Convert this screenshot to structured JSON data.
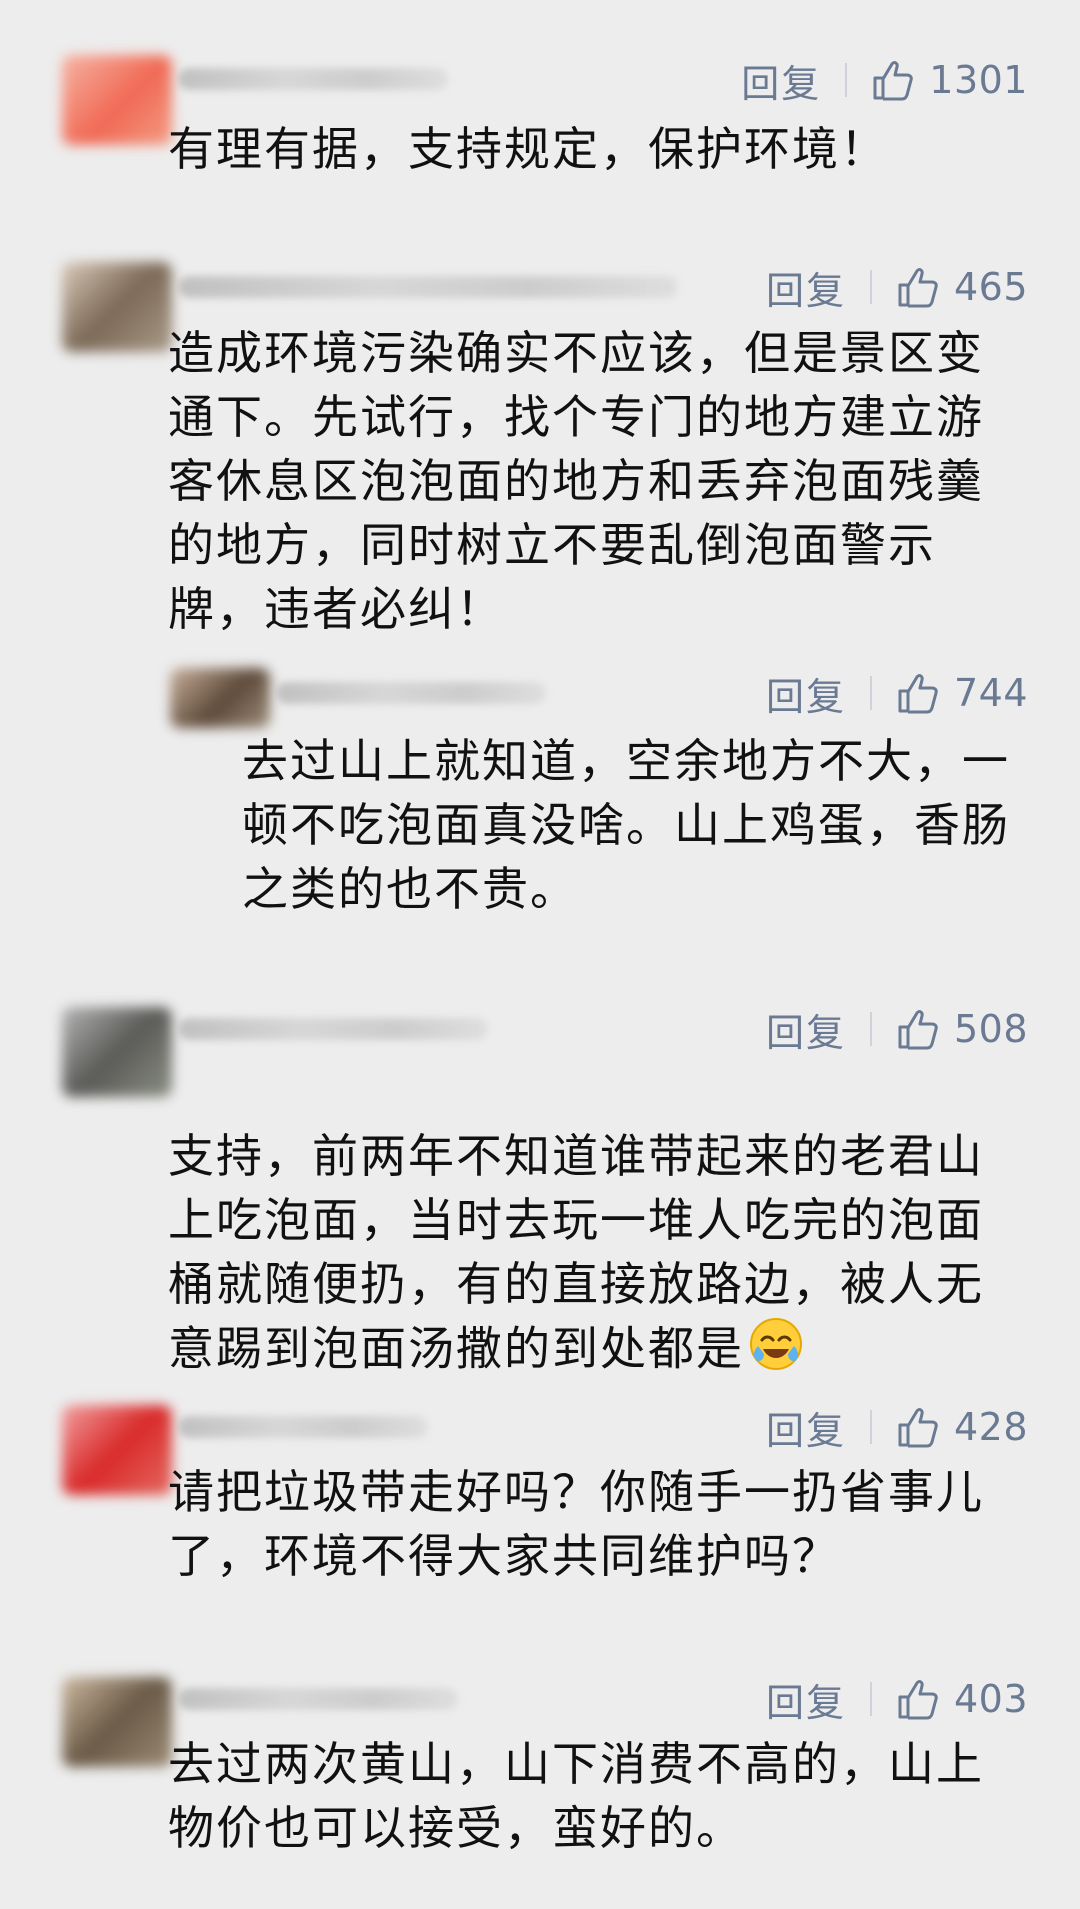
{
  "comments": [
    {
      "reply_label": "回复",
      "likes": "1301",
      "text": "有理有据，支持规定，保护环境！"
    },
    {
      "reply_label": "回复",
      "likes": "465",
      "text": "造成环境污染确实不应该，但是景区变\n通下。先试行，找个专门的地方建立游\n客休息区泡泡面的地方和丢弃泡面残羹\n的地方，同时树立不要乱倒泡面警示\n牌，违者必纠！"
    },
    {
      "reply_label": "回复",
      "likes": "744",
      "text": "去过山上就知道，空余地方不大，一\n顿不吃泡面真没啥。山上鸡蛋，香肠\n之类的也不贵。"
    },
    {
      "reply_label": "回复",
      "likes": "508",
      "text": "支持，前两年不知道谁带起来的老君山\n上吃泡面，当时去玩一堆人吃完的泡面\n桶就随便扔，有的直接放路边，被人无\n意踢到泡面汤撒的到处都是"
    },
    {
      "reply_label": "回复",
      "likes": "428",
      "text": "请把垃圾带走好吗？你随手一扔省事儿\n了，环境不得大家共同维护吗？"
    },
    {
      "reply_label": "回复",
      "likes": "403",
      "text": "去过两次黄山，山下消费不高的，山上\n物价也可以接受，蛮好的。"
    }
  ],
  "icons": {
    "like": "thumbs-up-icon",
    "emoji": "laugh-cry-emoji"
  },
  "colors": {
    "background": "#ededed",
    "action": "#6a7a92",
    "text": "#111111"
  }
}
